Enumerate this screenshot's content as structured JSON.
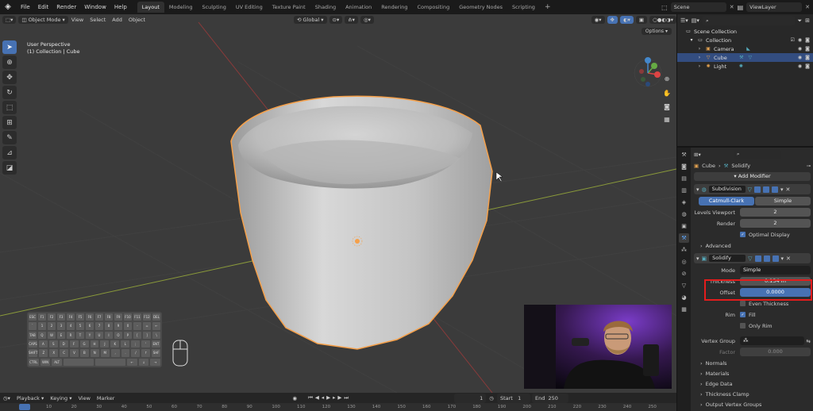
{
  "topbar": {
    "menus": [
      "File",
      "Edit",
      "Render",
      "Window",
      "Help"
    ],
    "workspaces": [
      "Layout",
      "Modeling",
      "Sculpting",
      "UV Editing",
      "Texture Paint",
      "Shading",
      "Animation",
      "Rendering",
      "Compositing",
      "Geometry Nodes",
      "Scripting"
    ],
    "active_workspace": "Layout",
    "add_workspace": "+",
    "scene": "Scene",
    "view_layer": "ViewLayer"
  },
  "viewport_header": {
    "mode": "Object Mode",
    "menus": [
      "View",
      "Select",
      "Add",
      "Object"
    ],
    "orientation": "Global",
    "options": "Options"
  },
  "viewport_info": {
    "line1": "User Perspective",
    "line2": "(1) Collection | Cube"
  },
  "keyboard": {
    "rows": [
      [
        "ESC",
        "F1",
        "F2",
        "F3",
        "F4",
        "F5",
        "F6",
        "F7",
        "F8",
        "F9",
        "F10",
        "F11",
        "F12",
        "DEL"
      ],
      [
        "`",
        "1",
        "2",
        "3",
        "4",
        "5",
        "6",
        "7",
        "8",
        "9",
        "0",
        "-",
        "=",
        "←"
      ],
      [
        "TAB",
        "Q",
        "W",
        "E",
        "R",
        "T",
        "Y",
        "U",
        "I",
        "O",
        "P",
        "[",
        "]",
        "\\"
      ],
      [
        "CAPS",
        "A",
        "S",
        "D",
        "F",
        "G",
        "H",
        "J",
        "K",
        "L",
        ";",
        "'",
        "ENT"
      ],
      [
        "SHIFT",
        "Z",
        "X",
        "C",
        "V",
        "B",
        "N",
        "M",
        ",",
        ".",
        "/",
        "↑",
        "SHF"
      ],
      [
        "CTRL",
        "WIN",
        "ALT",
        "",
        "",
        "←",
        "↓",
        "→"
      ]
    ]
  },
  "timeline": {
    "menus": [
      "Playback",
      "Keying",
      "View",
      "Marker"
    ],
    "current_frame": "1",
    "start_label": "Start",
    "start": "1",
    "end_label": "End",
    "end": "250",
    "ruler": [
      "10",
      "20",
      "30",
      "40",
      "50",
      "60",
      "70",
      "80",
      "90",
      "100",
      "110",
      "120",
      "130",
      "140",
      "150",
      "160",
      "170",
      "180",
      "190",
      "200",
      "210",
      "220",
      "230",
      "240",
      "250"
    ]
  },
  "outliner": {
    "search_placeholder": "",
    "scene_collection": "Scene Collection",
    "collection": "Collection",
    "items": [
      {
        "name": "Camera",
        "selected": false
      },
      {
        "name": "Cube",
        "selected": true
      },
      {
        "name": "Light",
        "selected": false
      }
    ]
  },
  "properties": {
    "search_placeholder": "",
    "breadcrumb_object": "Cube",
    "breadcrumb_modifier": "Solidify",
    "add_modifier": "Add Modifier",
    "subdivision": {
      "name": "Subdivision",
      "catmull": "Catmull-Clark",
      "simple": "Simple",
      "levels_viewport_label": "Levels Viewport",
      "levels_viewport": "2",
      "render_label": "Render",
      "render": "2",
      "optimal_display": "Optimal Display",
      "advanced": "Advanced"
    },
    "solidify": {
      "name": "Solidify",
      "mode_label": "Mode",
      "mode": "Simple",
      "thickness_label": "Thickness",
      "thickness": "0.134 m",
      "offset_label": "Offset",
      "offset": "0.0000",
      "even_thickness": "Even Thickness",
      "rim_label": "Rim",
      "fill": "Fill",
      "only_rim": "Only Rim",
      "vertex_group_label": "Vertex Group",
      "factor_label": "Factor",
      "factor": "0.000",
      "sections": [
        "Normals",
        "Materials",
        "Edge Data",
        "Thickness Clamp",
        "Output Vertex Groups"
      ]
    }
  },
  "colors": {
    "accent": "#4772b3",
    "selection_outline": "#f5a04a",
    "highlight_box": "#e31c1c"
  }
}
